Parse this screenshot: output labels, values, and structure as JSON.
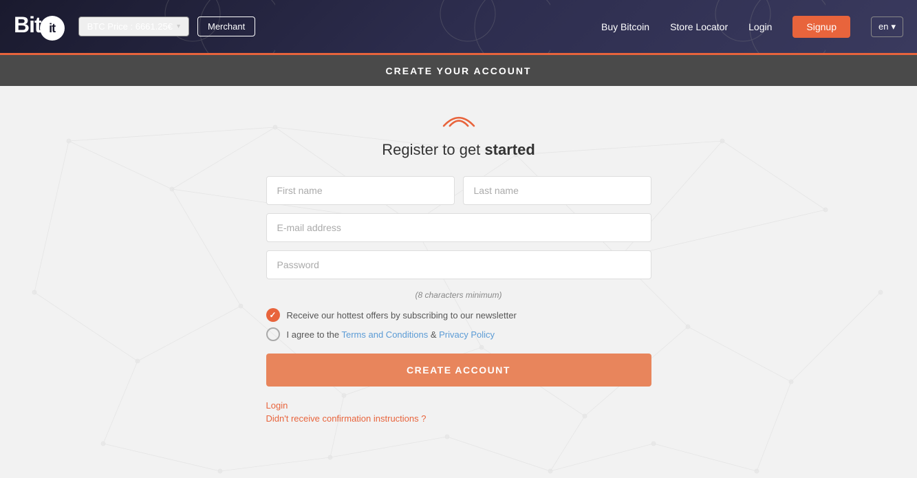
{
  "header": {
    "logo_bit": "Bit",
    "logo_it": "it",
    "btc_price_label": "BTC Price : 6661.25€",
    "btc_price_arrow": "▾",
    "merchant_label": "Merchant",
    "nav": {
      "buy_bitcoin": "Buy Bitcoin",
      "store_locator": "Store Locator",
      "login": "Login",
      "signup": "Signup",
      "language": "en",
      "language_arrow": "▾"
    }
  },
  "subheader": {
    "title": "CREATE YOUR ACCOUNT"
  },
  "main": {
    "register_title_normal": "Register to get ",
    "register_title_bold": "started",
    "first_name_placeholder": "First name",
    "last_name_placeholder": "Last name",
    "email_placeholder": "E-mail address",
    "password_placeholder": "Password",
    "password_hint": "(8 characters minimum)",
    "newsletter_label": "Receive our hottest offers by subscribing to our newsletter",
    "terms_label_prefix": "I agree to the ",
    "terms_link": "Terms and Conditions",
    "terms_label_ampersand": " & ",
    "privacy_link": "Privacy Policy",
    "create_account_btn": "CREATE ACCOUNT",
    "login_link": "Login",
    "resend_link": "Didn't receive confirmation instructions ?"
  }
}
